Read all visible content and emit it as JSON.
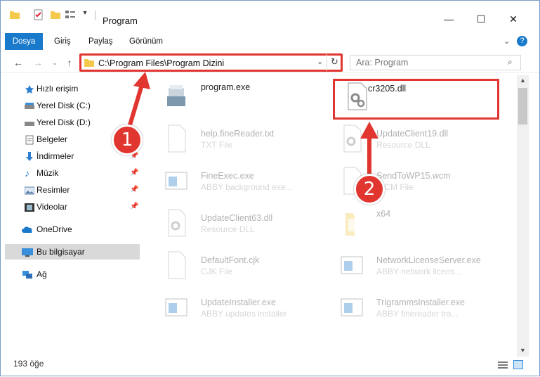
{
  "window": {
    "title": "Program",
    "controls": {
      "minimize": "—",
      "maximize": "☐",
      "close": "✕"
    }
  },
  "ribbon": {
    "tabs": [
      {
        "label": "Dosya",
        "active": true
      },
      {
        "label": "Giriş"
      },
      {
        "label": "Paylaş"
      },
      {
        "label": "Görünüm"
      }
    ]
  },
  "address_bar": {
    "path": "C:\\Program Files\\Program Dizini"
  },
  "search": {
    "placeholder": "Ara: Program"
  },
  "nav_pane": {
    "items": [
      {
        "label": "Hızlı erişim",
        "icon": "star-icon"
      },
      {
        "label": "Yerel Disk (C:)",
        "icon": "drive-icon"
      },
      {
        "label": "Yerel Disk (D:)",
        "icon": "drive-icon"
      },
      {
        "label": "Belgeler",
        "icon": "documents-icon"
      },
      {
        "label": "İndirmeler",
        "icon": "download-icon",
        "pinned": true
      },
      {
        "label": "Müzik",
        "icon": "music-icon",
        "pinned": true
      },
      {
        "label": "Resimler",
        "icon": "pictures-icon",
        "pinned": true
      },
      {
        "label": "Videolar",
        "icon": "videos-icon",
        "pinned": true
      },
      {
        "label": "OneDrive",
        "icon": "cloud-icon"
      },
      {
        "label": "Bu bilgisayar",
        "icon": "computer-icon",
        "selected": true
      },
      {
        "label": "Ağ",
        "icon": "network-icon"
      }
    ]
  },
  "files": [
    {
      "name": "program.exe",
      "desc": "",
      "icon": "installer-icon",
      "dim": false
    },
    {
      "name": "cr3205.dll",
      "desc": "",
      "icon": "dll-icon",
      "dim": false
    },
    {
      "name": "help.fineReader.txt",
      "desc": "TXT File",
      "icon": "text-file-icon",
      "dim": true
    },
    {
      "name": "UpdateClient19.dll",
      "desc": "Resource DLL",
      "icon": "dll-icon",
      "dim": true
    },
    {
      "name": "FineExec.exe",
      "desc": "ABBY background exe...",
      "icon": "exe-icon",
      "dim": true
    },
    {
      "name": "SendToWP15.wcm",
      "desc": "WCM File",
      "icon": "text-file-icon",
      "dim": true
    },
    {
      "name": "UpdateClient63.dll",
      "desc": "Resource DLL",
      "icon": "dll-icon",
      "dim": true
    },
    {
      "name": "x64",
      "desc": "",
      "icon": "folder-icon",
      "dim": true
    },
    {
      "name": "DefaultFont.cjk",
      "desc": "CJK File",
      "icon": "text-file-icon",
      "dim": true
    },
    {
      "name": "NetworkLicenseServer.exe",
      "desc": "ABBY network licens...",
      "icon": "exe-icon",
      "dim": true
    },
    {
      "name": "UpdateInstaller.exe",
      "desc": "ABBY updates installer",
      "icon": "exe-icon",
      "dim": true
    },
    {
      "name": "TrigrammsInstaller.exe",
      "desc": "ABBY finereader tra...",
      "icon": "exe-icon",
      "dim": true
    }
  ],
  "status": {
    "item_count": "193 öğe"
  },
  "annotations": [
    {
      "number": "1",
      "target": "address-bar"
    },
    {
      "number": "2",
      "target": "cr3205.dll"
    }
  ],
  "colors": {
    "accent": "#1979ca",
    "annotation": "#e1352f"
  }
}
